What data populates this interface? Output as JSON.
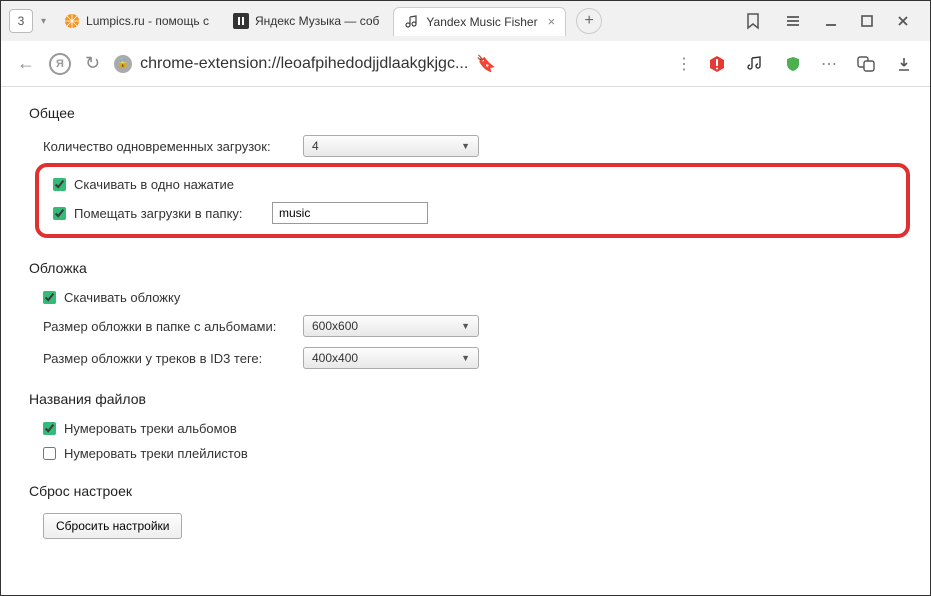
{
  "tabs": {
    "count": "3",
    "items": [
      {
        "label": "Lumpics.ru - помощь с",
        "icon": "orange"
      },
      {
        "label": "Яндекс Музыка — соб",
        "icon": "pause"
      },
      {
        "label": "Yandex Music Fisher",
        "icon": "music"
      }
    ]
  },
  "address": {
    "url": "chrome-extension://leoafpihedodjjdlaakgkjgc..."
  },
  "sections": {
    "general": {
      "title": "Общее",
      "downloads_label": "Количество одновременных загрузок:",
      "downloads_value": "4",
      "one_click_label": "Скачивать в одно нажатие",
      "folder_label": "Помещать загрузки в папку:",
      "folder_value": "music"
    },
    "cover": {
      "title": "Обложка",
      "download_cover_label": "Скачивать обложку",
      "cover_album_label": "Размер обложки в папке с альбомами:",
      "cover_album_value": "600x600",
      "cover_id3_label": "Размер обложки у треков в ID3 теге:",
      "cover_id3_value": "400x400"
    },
    "filenames": {
      "title": "Названия файлов",
      "number_albums_label": "Нумеровать треки альбомов",
      "number_playlists_label": "Нумеровать треки плейлистов"
    },
    "reset": {
      "title": "Сброс настроек",
      "button_label": "Сбросить настройки"
    }
  }
}
